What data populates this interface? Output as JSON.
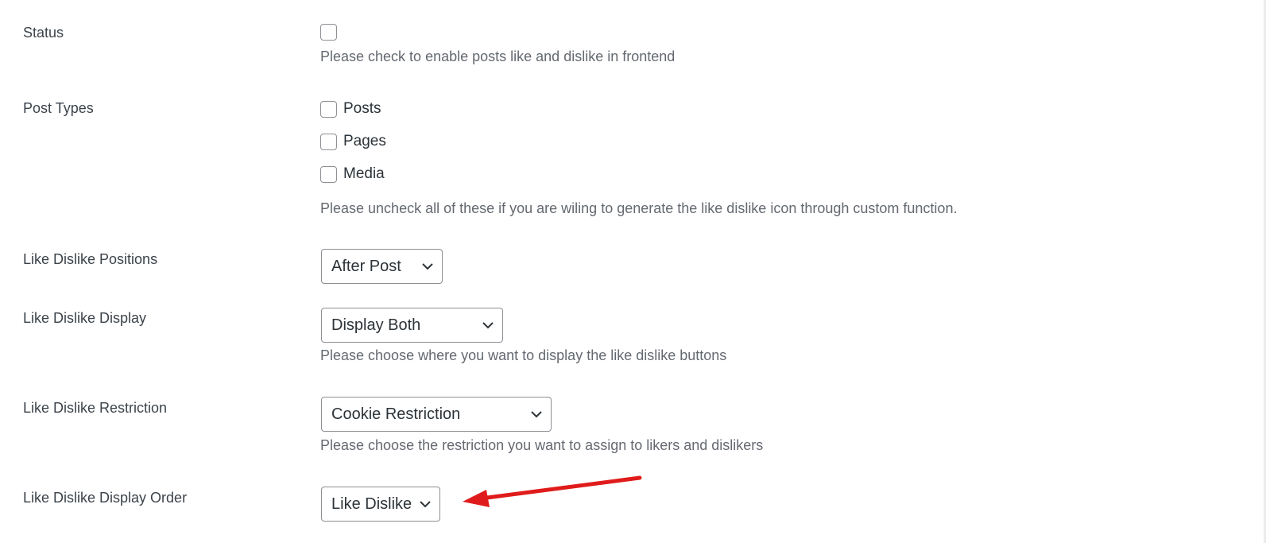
{
  "settings": {
    "status": {
      "label": "Status",
      "checked": false,
      "description": "Please check to enable posts like and dislike in frontend"
    },
    "post_types": {
      "label": "Post Types",
      "options": [
        {
          "label": "Posts",
          "checked": false
        },
        {
          "label": "Pages",
          "checked": false
        },
        {
          "label": "Media",
          "checked": false
        }
      ],
      "description": "Please uncheck all of these if you are wiling to generate the like dislike icon through custom function."
    },
    "positions": {
      "label": "Like Dislike Positions",
      "selected": "After Post"
    },
    "display": {
      "label": "Like Dislike Display",
      "selected": "Display Both",
      "description": "Please choose where you want to display the like dislike buttons"
    },
    "restriction": {
      "label": "Like Dislike Restriction",
      "selected": "Cookie Restriction",
      "description": "Please choose the restriction you want to assign to likers and dislikers"
    },
    "display_order": {
      "label": "Like Dislike Display Order",
      "selected": "Like Dislike"
    }
  },
  "annotation": {
    "type": "arrow",
    "color": "#e01b1b",
    "points_to": "display_order"
  },
  "icons": {
    "select_chevron": "chevron-down-icon"
  }
}
